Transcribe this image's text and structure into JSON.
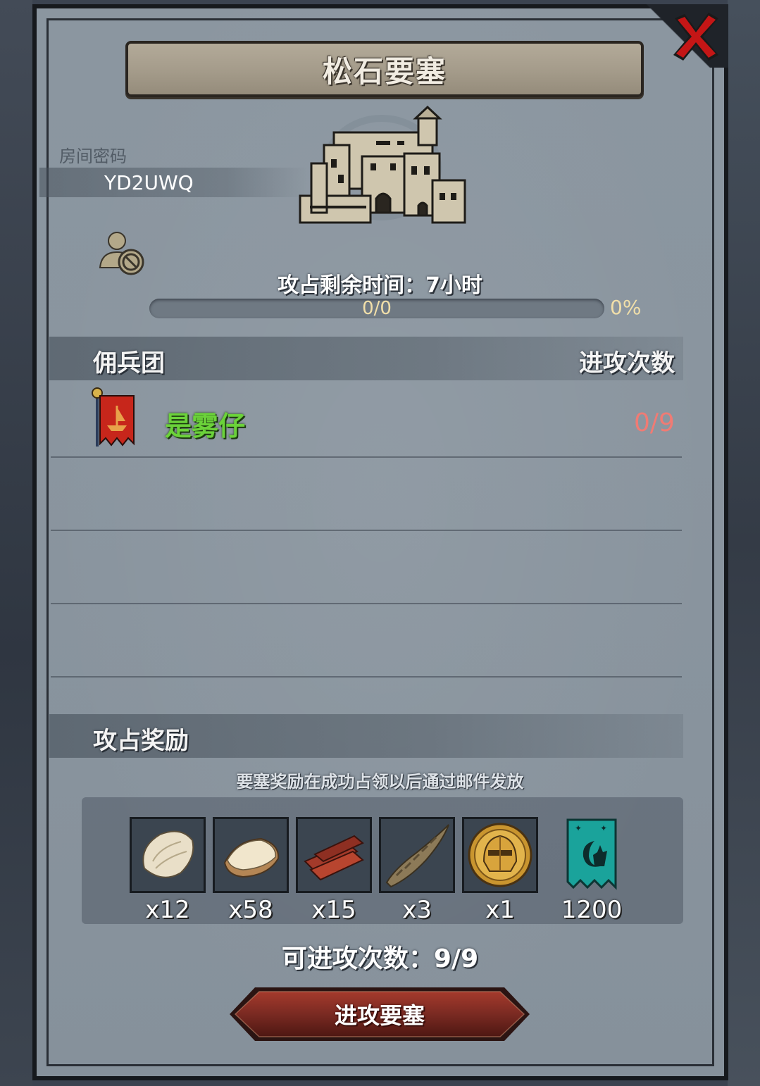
{
  "dialog": {
    "title": "松石要塞"
  },
  "room": {
    "label": "房间密码",
    "code": "YD2UWQ"
  },
  "timer": {
    "text": "攻占剩余时间：7小时"
  },
  "progress": {
    "text": "0/0",
    "percent_label": "0%",
    "fraction": 0
  },
  "mercenary": {
    "header": "佣兵团",
    "attacks_header": "进攻次数",
    "rows": [
      {
        "name": "是雾仔",
        "count": "0/9"
      }
    ]
  },
  "rewards": {
    "header": "攻占奖励",
    "note": "要塞奖励在成功占领以后通过邮件发放",
    "items": [
      {
        "icon": "fur-pelt-icon",
        "count": "x12"
      },
      {
        "icon": "wool-fleece-icon",
        "count": "x58"
      },
      {
        "icon": "wood-planks-icon",
        "count": "x15"
      },
      {
        "icon": "horn-icon",
        "count": "x3"
      },
      {
        "icon": "knight-helmet-coin-icon",
        "count": "x1"
      },
      {
        "icon": "banner-points-icon",
        "count": "1200"
      }
    ]
  },
  "attempts": {
    "text": "可进攻次数：9/9"
  },
  "actions": {
    "attack_label": "进攻要塞"
  },
  "colors": {
    "guild_name": "#6bd23a",
    "attack_count": "#f07b74",
    "close_x": "#c41616",
    "attack_button": "#7a2a22"
  }
}
